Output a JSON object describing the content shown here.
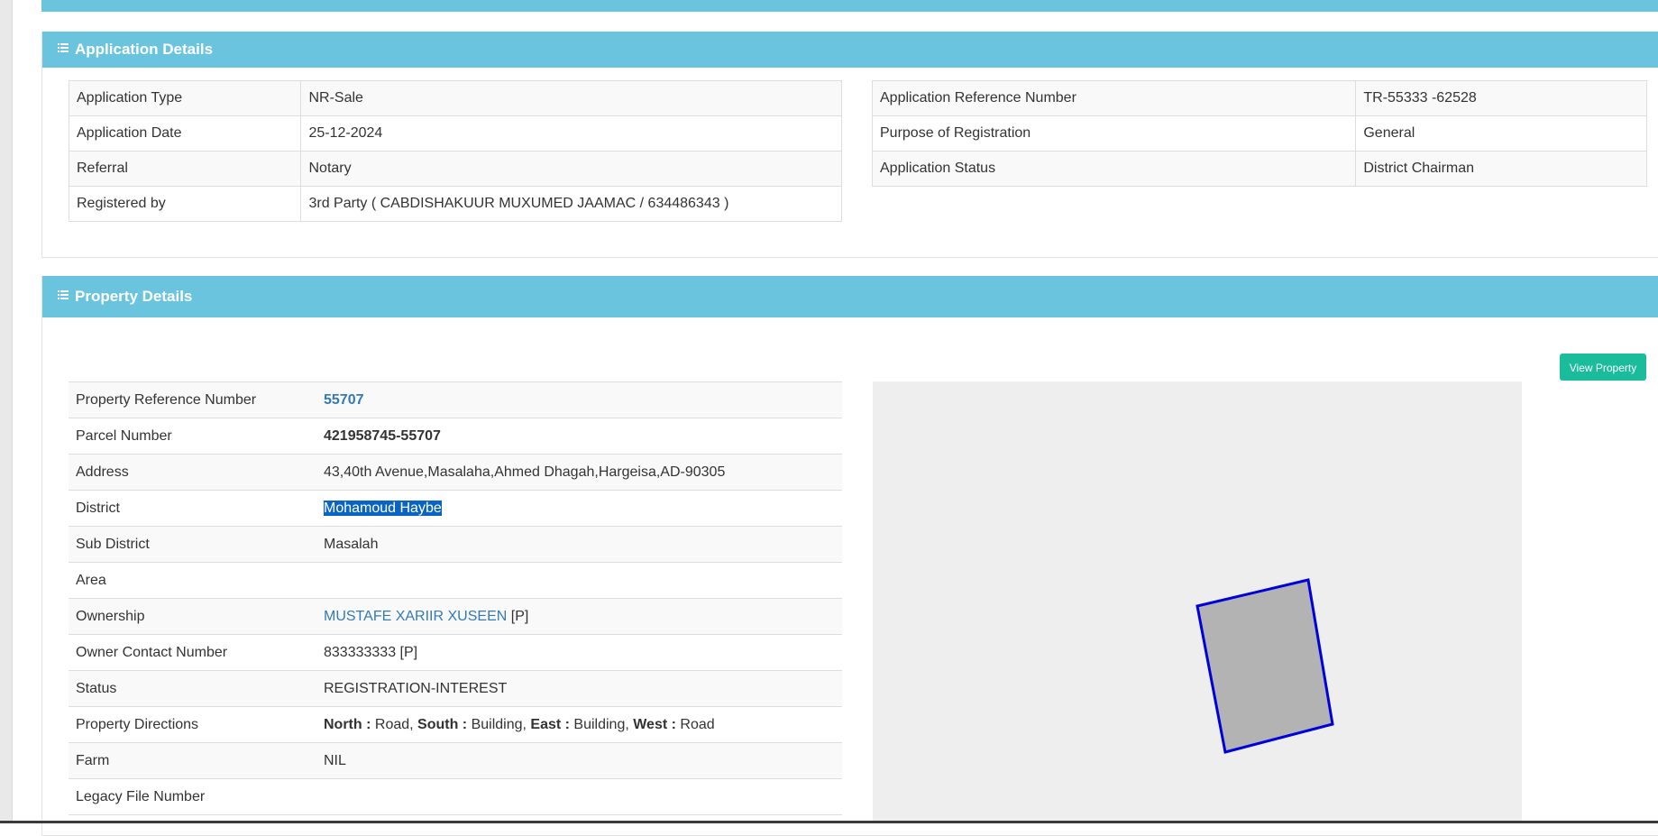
{
  "application_details": {
    "title": "Application Details",
    "left_rows": [
      {
        "label": "Application Type",
        "value": "NR-Sale"
      },
      {
        "label": "Application Date",
        "value": "25-12-2024"
      },
      {
        "label": "Referral",
        "value": "Notary"
      },
      {
        "label": "Registered by",
        "value": "3rd Party ( CABDISHAKUUR MUXUMED JAAMAC / 634486343 )"
      }
    ],
    "right_rows": [
      {
        "label": "Application Reference Number",
        "value": "TR-55333 -62528"
      },
      {
        "label": "Purpose of Registration",
        "value": "General"
      },
      {
        "label": "Application Status",
        "value": "District Chairman"
      }
    ]
  },
  "property_details": {
    "title": "Property Details",
    "view_property_label": "View Property",
    "rows": {
      "property_reference_number": {
        "label": "Property Reference Number",
        "value": "55707"
      },
      "parcel_number": {
        "label": "Parcel Number",
        "value": "421958745-55707"
      },
      "address": {
        "label": "Address",
        "value": "43,40th Avenue,Masalaha,Ahmed Dhagah,Hargeisa,AD-90305"
      },
      "district": {
        "label": "District",
        "value": "Mohamoud Haybe"
      },
      "sub_district": {
        "label": "Sub District",
        "value": "Masalah"
      },
      "area": {
        "label": "Area",
        "value": ""
      },
      "ownership": {
        "label": "Ownership",
        "owner_name": "MUSTAFE XARIIR XUSEEN",
        "suffix": " [P]"
      },
      "owner_contact": {
        "label": "Owner Contact Number",
        "value": "833333333 [P]"
      },
      "status": {
        "label": "Status",
        "value": "REGISTRATION-INTEREST"
      },
      "directions": {
        "label": "Property Directions",
        "north_label": "North :",
        "north": " Road, ",
        "south_label": "South :",
        "south": " Building, ",
        "east_label": "East :",
        "east": " Building, ",
        "west_label": "West :",
        "west": " Road"
      },
      "farm": {
        "label": "Farm",
        "value": "NIL"
      },
      "legacy_file_number": {
        "label": "Legacy File Number",
        "value": ""
      }
    }
  },
  "map": {
    "parcel_fill": "#b3b3b3",
    "parcel_stroke": "#0000dd"
  },
  "colors": {
    "header": "#6ac4de",
    "button": "#1abc9c",
    "link": "#337ab7",
    "selection": "#0a64c2"
  }
}
